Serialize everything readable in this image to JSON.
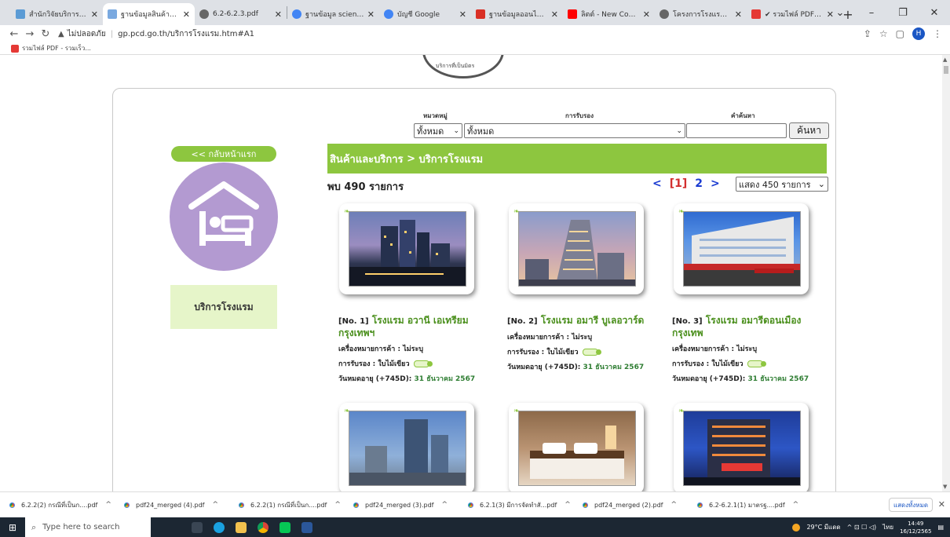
{
  "browser": {
    "tabs": [
      {
        "label": "สำนักวิจัยบริการพลังงาน",
        "color": "#5b9bd5"
      },
      {
        "label": "ฐานข้อมูลสินค้าและบริการ",
        "color": "#7aa9e0",
        "active": true
      },
      {
        "label": "6.2-6.2.3.pdf",
        "color": "#666666"
      },
      {
        "label": "ฐานข้อมูล science direct",
        "color": "#4285f4"
      },
      {
        "label": "บัญชี Google",
        "color": "#4285f4"
      },
      {
        "label": "ฐานข้อมูลออนไลน์ของสำ",
        "color": "#d93025"
      },
      {
        "label": "ลิตต์ - New Country [",
        "color": "#ff0000"
      },
      {
        "label": "โครงการโรงแรมที่เป็นมิตร",
        "color": "#666666"
      },
      {
        "label": "✔ รวมไฟล์ PDF - รวมห",
        "color": "#e53935"
      }
    ],
    "url_warning": "ไม่ปลอดภัย",
    "url": "gp.pcd.go.th/บริการโรงแรม.htm#A1",
    "profile_initial": "H",
    "bookmark": "รวมไฟล์ PDF - รวมเร็ว..."
  },
  "page": {
    "seal_text": "บริการที่เป็นมิตร",
    "filters": {
      "category_label": "หมวดหมู่",
      "cert_label": "การรับรอง",
      "search_label": "คำค้นหา",
      "category_value": "ทั้งหมด",
      "cert_value": "ทั้งหมด",
      "search_button": "ค้นหา"
    },
    "breadcrumb": {
      "root": "สินค้าและบริการ",
      "sep": " > ",
      "current": "บริการโรงแรม"
    },
    "back_button": "<< กลับหน้าแรก",
    "category_box": "บริการโรงแรม",
    "results": {
      "count_text": "พบ 490 รายการ",
      "prev": "<",
      "current_page": "[1]",
      "next_page": "2",
      "next": ">",
      "show_select": "แสดง 450 รายการ"
    },
    "items": [
      {
        "num": "[No. 1]",
        "name": "โรงแรม อวานี เอเทรียม กรุงเทพฯ",
        "brand": "เครื่องหมายการค้า : ไม่ระบุ",
        "cert": "การรับรอง : ใบไม้เขียว",
        "expiry_label": "วันหมดอายุ (+745D):",
        "expiry_date": "31 ธันวาคม 2567"
      },
      {
        "num": "[No. 2]",
        "name": "โรงแรม อมารี บูเลอวาร์ด",
        "brand": "เครื่องหมายการค้า : ไม่ระบุ",
        "cert": "การรับรอง : ใบไม้เขียว",
        "expiry_label": "วันหมดอายุ (+745D):",
        "expiry_date": "31 ธันวาคม 2567"
      },
      {
        "num": "[No. 3]",
        "name": "โรงแรม อมารีดอนเมือง กรุงเทพ",
        "brand": "เครื่องหมายการค้า : ไม่ระบุ",
        "cert": "การรับรอง : ใบไม้เขียว",
        "expiry_label": "วันหมดอายุ (+745D):",
        "expiry_date": "31 ธันวาคม 2567"
      }
    ]
  },
  "downloads": {
    "files": [
      "6.2.2(2) กรณีที่เป็นก....pdf",
      "pdf24_merged (4).pdf",
      "6.2.2(1) กรณีที่เป็นก....pdf",
      "pdf24_merged (3).pdf",
      "6.2.1(3) มีการจัดทำสั...pdf",
      "pdf24_merged (2).pdf",
      "6.2-6.2.1(1) มาตรฐ....pdf"
    ],
    "show_all": "แสดงทั้งหมด"
  },
  "taskbar": {
    "search_placeholder": "Type here to search",
    "weather": "29°C มีแดด",
    "lang": "ไทย",
    "time": "14:49",
    "date": "16/12/2565"
  }
}
